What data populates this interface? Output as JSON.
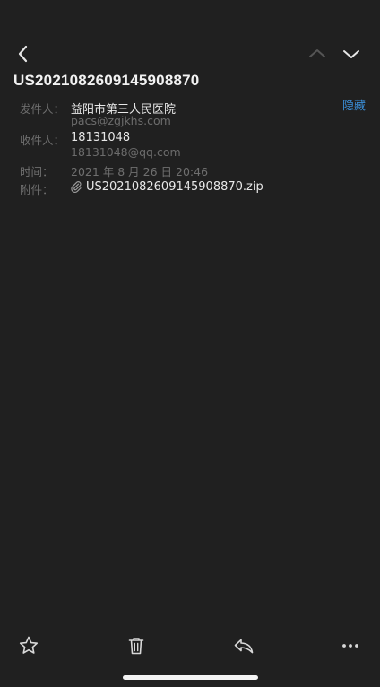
{
  "header": {
    "subject": "US2021082609145908870",
    "hide_label": "隐藏"
  },
  "fields": {
    "from_label": "发件人：",
    "from_name": "益阳市第三人民医院",
    "from_email": "pacs@zgjkhs.com",
    "to_label": "收件人：",
    "to_name": "18131048",
    "to_email": "18131048@qq.com",
    "time_label": "时间：",
    "time_value": "2021 年 8 月 26 日 20:46",
    "attachment_label": "附件：",
    "attachment_name": "US2021082609145908870.zip"
  },
  "icons": {
    "back": "chevron-left-icon",
    "prev": "chevron-up-icon",
    "next": "chevron-down-icon",
    "attachment": "paperclip-icon",
    "star": "star-icon",
    "trash": "trash-icon",
    "reply": "reply-icon",
    "more": "more-icon"
  },
  "colors": {
    "background": "#202020",
    "accent": "#3a8fd9",
    "text_primary": "#e8e8e8",
    "text_secondary": "#6e6e6e"
  }
}
